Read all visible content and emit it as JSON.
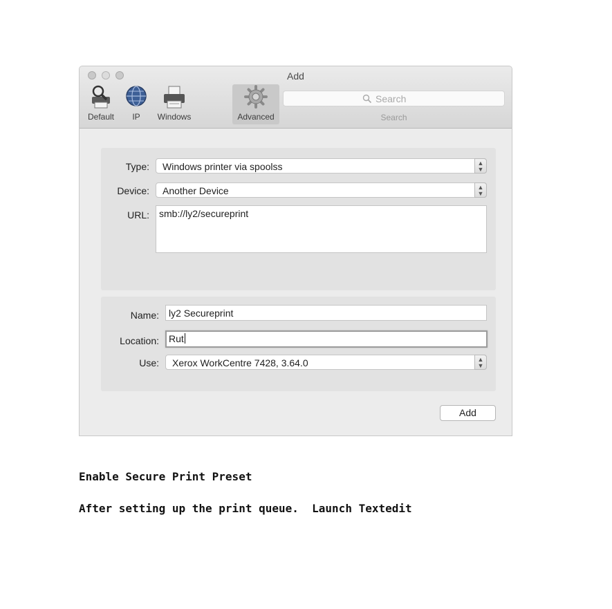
{
  "window": {
    "title": "Add",
    "toolbar": [
      {
        "label": "Default",
        "icon": "magnifier-printer-icon"
      },
      {
        "label": "IP",
        "icon": "globe-icon"
      },
      {
        "label": "Windows",
        "icon": "printer-icon"
      },
      {
        "label": "Advanced",
        "icon": "gear-icon",
        "selected": true
      }
    ],
    "search": {
      "placeholder": "Search",
      "label": "Search"
    }
  },
  "connection": {
    "type_label": "Type:",
    "type_value": "Windows printer via spoolss",
    "device_label": "Device:",
    "device_value": "Another Device",
    "url_label": "URL:",
    "url_value": "smb://ly2/secureprint"
  },
  "details": {
    "name_label": "Name:",
    "name_value": "ly2 Secureprint",
    "location_label": "Location:",
    "location_value": "Rut",
    "use_label": "Use:",
    "use_value": "Xerox WorkCentre 7428, 3.64.0"
  },
  "add_button": "Add",
  "doc": {
    "heading": "Enable Secure Print Preset",
    "line": "After setting up the print queue.  Launch Textedit"
  }
}
